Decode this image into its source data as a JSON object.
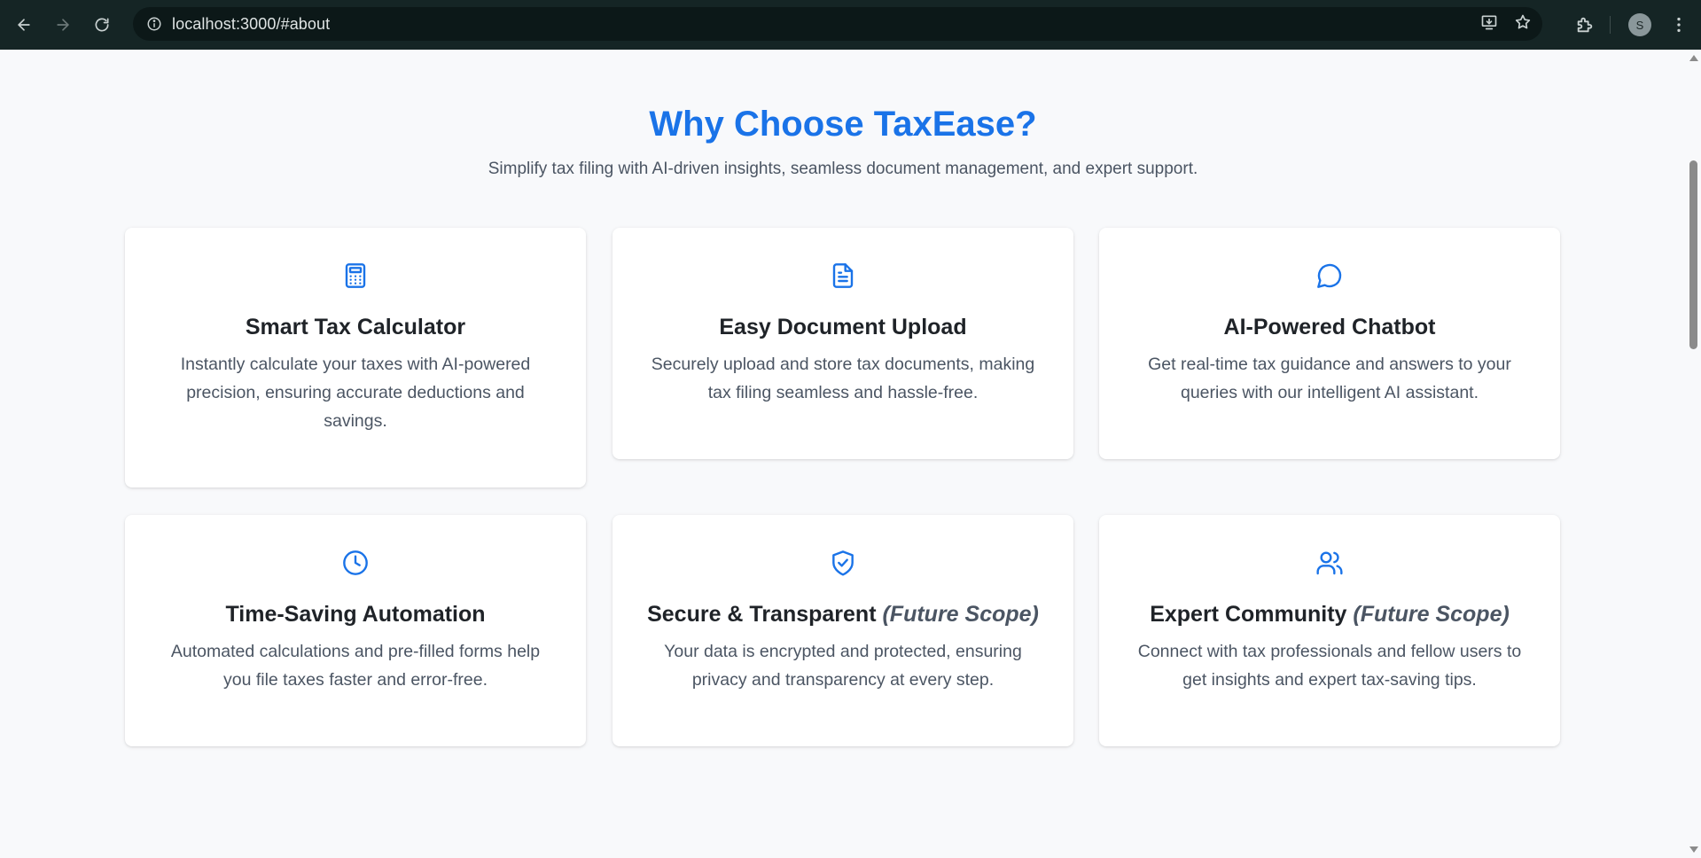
{
  "browser": {
    "url": "localhost:3000/#about",
    "profile_initial": "S"
  },
  "section": {
    "title": "Why Choose TaxEase?",
    "subtitle": "Simplify tax filing with AI-driven insights, seamless document management, and expert support."
  },
  "features": [
    {
      "icon": "calculator-icon",
      "title": "Smart Tax Calculator",
      "tag": "",
      "description": "Instantly calculate your taxes with AI-powered precision, ensuring accurate deductions and savings."
    },
    {
      "icon": "document-icon",
      "title": "Easy Document Upload",
      "tag": "",
      "description": "Securely upload and store tax documents, making tax filing seamless and hassle-free."
    },
    {
      "icon": "chat-bubble-icon",
      "title": "AI-Powered Chatbot",
      "tag": "",
      "description": "Get real-time tax guidance and answers to your queries with our intelligent AI assistant."
    },
    {
      "icon": "clock-icon",
      "title": "Time-Saving Automation",
      "tag": "",
      "description": "Automated calculations and pre-filled forms help you file taxes faster and error-free."
    },
    {
      "icon": "shield-check-icon",
      "title": "Secure & Transparent",
      "tag": "(Future Scope)",
      "description": "Your data is encrypted and protected, ensuring privacy and transparency at every step."
    },
    {
      "icon": "users-icon",
      "title": "Expert Community",
      "tag": "(Future Scope)",
      "description": "Connect with tax professionals and fellow users to get insights and expert tax-saving tips."
    }
  ],
  "colors": {
    "accent": "#1a73e8",
    "chrome_bg": "#152525",
    "page_bg": "#f8f9fb",
    "card_bg": "#ffffff",
    "body_text": "#4b5563",
    "heading_text": "#1f2328"
  }
}
